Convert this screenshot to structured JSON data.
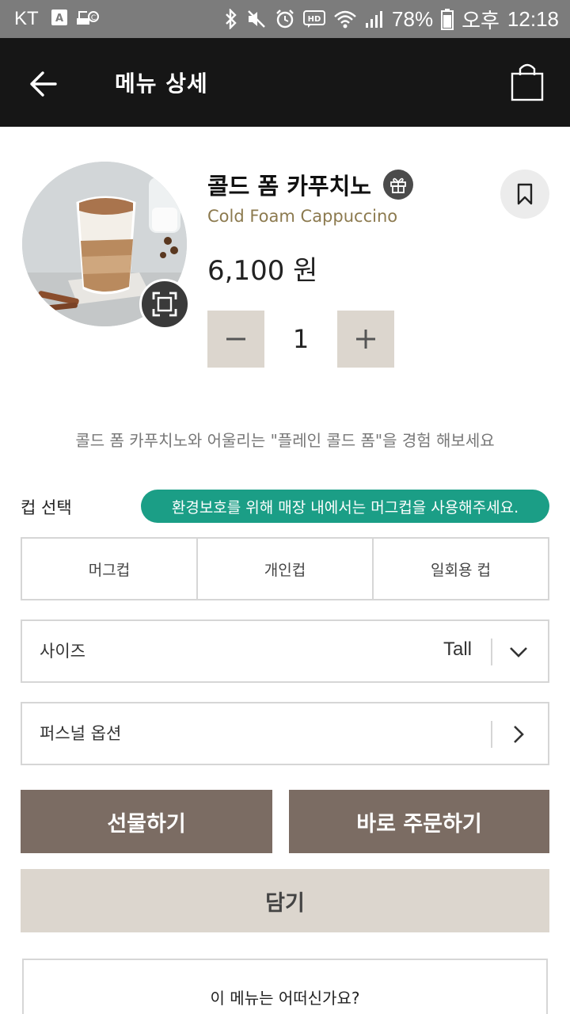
{
  "status_bar": {
    "carrier": "KT",
    "battery": "78%",
    "ampm": "오후",
    "time": "12:18"
  },
  "app_bar": {
    "title": "메뉴 상세",
    "back_icon": "arrow-left-icon",
    "cart_icon": "shopping-bag-icon"
  },
  "product": {
    "name_ko": "콜드 폼 카푸치노",
    "name_en": "Cold Foam Cappuccino",
    "price": "6,100 원",
    "quantity": "1",
    "gift_icon": "gift-icon",
    "bookmark_icon": "bookmark-icon",
    "zoom_icon": "expand-icon"
  },
  "promo_text": "콜드 폼 카푸치노와 어울리는 \"플레인 콜드 폼\"을 경험 해보세요",
  "cup": {
    "label": "컵 선택",
    "notice": "환경보호를 위해 매장 내에서는 머그컵을 사용해주세요.",
    "options": [
      "머그컵",
      "개인컵",
      "일회용 컵"
    ]
  },
  "size": {
    "label": "사이즈",
    "value": "Tall"
  },
  "personal_option": {
    "label": "퍼스널 옵션"
  },
  "actions": {
    "gift": "선물하기",
    "order_now": "바로 주문하기",
    "add_to_cart": "담기"
  },
  "review": {
    "label": "이 메뉴는 어떠신가요?"
  },
  "colors": {
    "app_bar": "#161616",
    "accent_teal": "#1b9e86",
    "primary_brown": "#7b6c63",
    "beige": "#dcd6ce",
    "gold_text": "#8c7a4f"
  }
}
